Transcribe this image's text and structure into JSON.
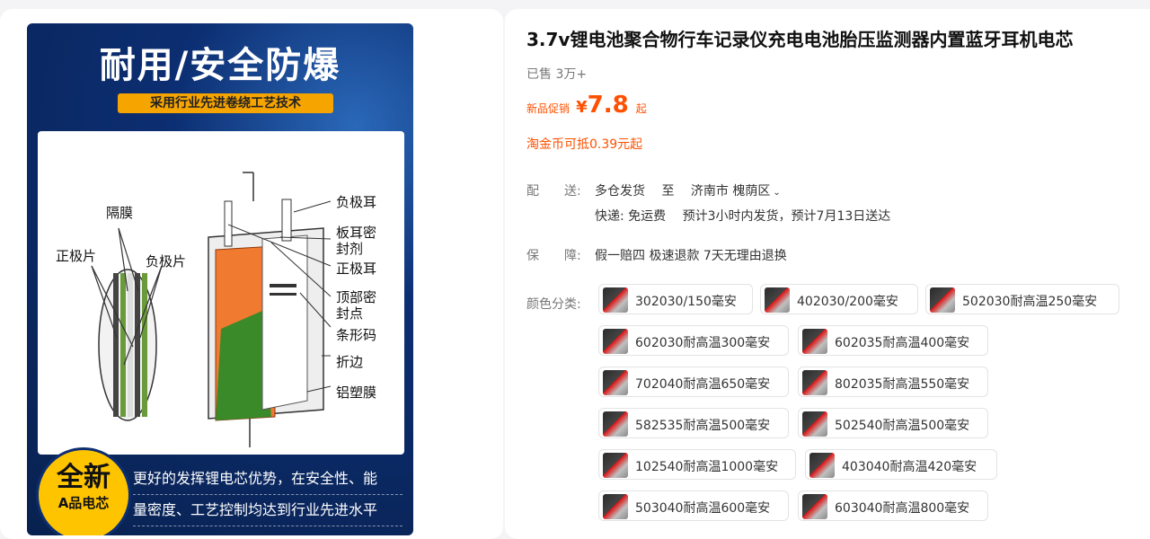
{
  "product_image": {
    "headline": "耐用/安全防爆",
    "subheadline": "采用行业先进卷绕工艺技术",
    "labels": {
      "separator": "隔膜",
      "cathode_left": "正极片",
      "anode_left": "负极片",
      "negative_tab": "负极耳",
      "tab_sealant_1": "板耳密",
      "tab_sealant_2": "封剂",
      "positive_tab": "正极耳",
      "top_seal_1": "顶部密",
      "top_seal_2": "封点",
      "barcode": "条形码",
      "fold_edge": "折边",
      "aluminum_film": "铝塑膜"
    },
    "badge_line1": "全新",
    "badge_line2": "A品电芯",
    "bottom_line1": "更好的发挥锂电芯优势，在安全性、能",
    "bottom_line2": "量密度、工艺控制均达到行业先进水平"
  },
  "product": {
    "title": "3.7v锂电池聚合物行车记录仪充电电池胎压监测器内置蓝牙耳机电芯",
    "sold": "已售 3万+",
    "price_label": "新品促销",
    "currency": "¥",
    "price": "7.8",
    "price_suffix": "起",
    "coin_note": "淘金币可抵0.39元起"
  },
  "shipping": {
    "label": "配　　送:",
    "from": "多仓发货",
    "to_word": "至",
    "destination": "济南市 槐荫区",
    "express": "快递: 免运费",
    "dispatch": "预计3小时内发货，预计7月13日送达"
  },
  "guarantee": {
    "label": "保　　障:",
    "value": "假一赔四 极速退款 7天无理由退换"
  },
  "color": {
    "label": "颜色分类:",
    "options": [
      "302030/150毫安",
      "402030/200毫安",
      "502030耐高温250毫安",
      "602030耐高温300毫安",
      "602035耐高温400毫安",
      "702040耐高温650毫安",
      "802035耐高温550毫安",
      "582535耐高温500毫安",
      "502540耐高温500毫安",
      "102540耐高温1000毫安",
      "403040耐高温420毫安",
      "503040耐高温600毫安",
      "603040耐高温800毫安"
    ]
  },
  "colors": {
    "accent": "#ff5000",
    "poster_bg": "#0c2e72",
    "badge": "#ffc400",
    "subheadline_bg": "#f6a400"
  }
}
